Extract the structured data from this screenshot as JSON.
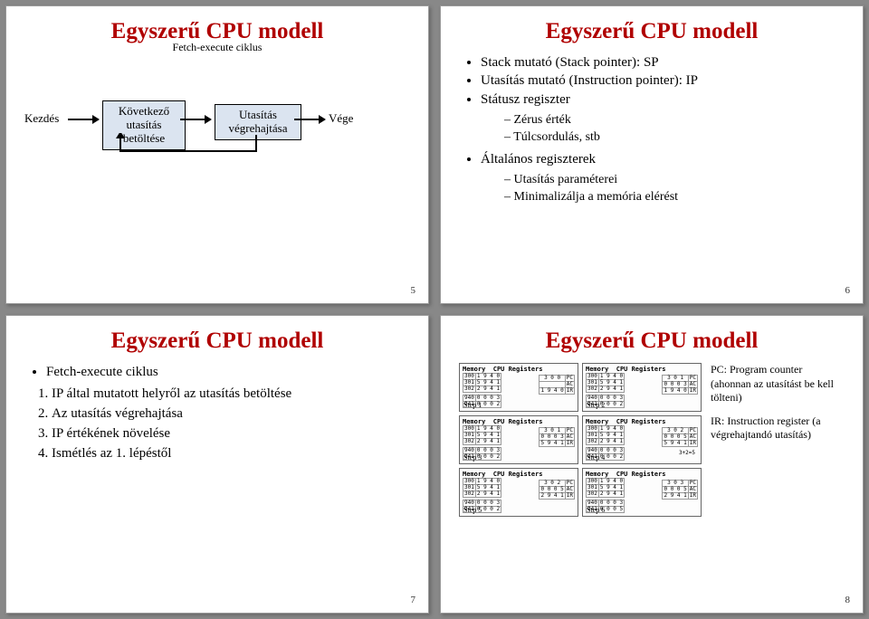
{
  "slide1": {
    "title": "Egyszerű CPU modell",
    "subtitle": "Fetch-execute ciklus",
    "flow": {
      "start": "Kezdés",
      "box1": "Következő utasítás betöltése",
      "box2": "Utasítás végrehajtása",
      "end": "Vége"
    },
    "page": "5"
  },
  "slide2": {
    "title": "Egyszerű CPU modell",
    "bullets": [
      "Stack mutató (Stack pointer): SP",
      "Utasítás mutató (Instruction pointer): IP",
      "Státusz regiszter"
    ],
    "sub1": [
      "Zérus érték",
      "Túlcsordulás, stb"
    ],
    "bullets2": [
      "Általános regiszterek"
    ],
    "sub2": [
      "Utasítás paraméterei",
      "Minimalizálja a memória elérést"
    ],
    "page": "6"
  },
  "slide3": {
    "title": "Egyszerű CPU modell",
    "lead": "Fetch-execute ciklus",
    "steps": [
      "IP által mutatott helyről az utasítás betöltése",
      "Az utasítás végrehajtása",
      "IP értékének növelése",
      "Ismétlés az 1. lépéstől"
    ],
    "page": "7"
  },
  "slide4": {
    "title": "Egyszerű CPU modell",
    "side": {
      "pc": "PC: Program counter (ahonnan az utasítást be kell tölteni)",
      "ir": "IR: Instruction register (a végrehajtandó utasítás)"
    },
    "steplabels": [
      "Step 1",
      "Step 2",
      "Step 3",
      "Step 4",
      "Step 5",
      "Step 6"
    ],
    "mem_hdr": "Memory",
    "reg_hdr": "CPU Registers",
    "reg_names": [
      "PC",
      "AC",
      "IR"
    ],
    "page": "8"
  }
}
